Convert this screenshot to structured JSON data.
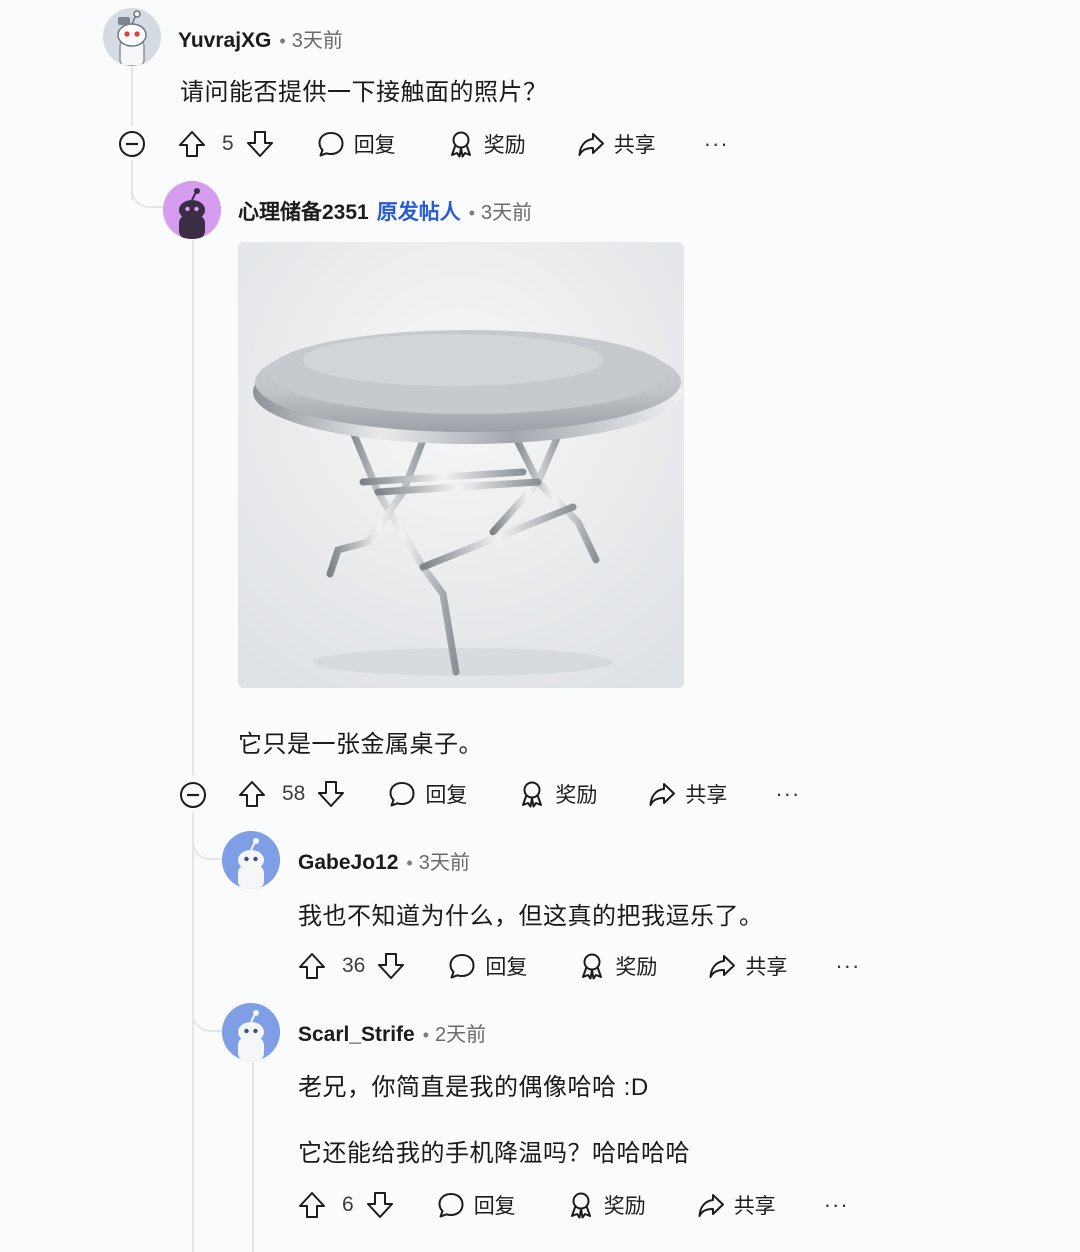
{
  "comments": [
    {
      "username": "YuvrajXG",
      "time": "3天前",
      "text": "请问能否提供一下接触面的照片？",
      "votes": "5"
    },
    {
      "username": "心理储备2351",
      "op_badge": "原发帖人",
      "time": "3天前",
      "text": "它只是一张金属桌子。",
      "votes": "58"
    },
    {
      "username": "GabeJo12",
      "time": "3天前",
      "text": "我也不知道为什么，但这真的把我逗乐了。",
      "votes": "36"
    },
    {
      "username": "Scarl_Strife",
      "time": "2天前",
      "text": "老兄，你简直是我的偶像哈哈 :D",
      "text2": "它还能给我的手机降温吗？哈哈哈哈",
      "votes": "6"
    }
  ],
  "actions": {
    "reply": "回复",
    "award": "奖励",
    "share": "共享",
    "more": "···"
  },
  "icons": [
    "upvote-icon",
    "downvote-icon",
    "reply-bubble-icon",
    "award-icon",
    "share-icon",
    "collapse-icon"
  ],
  "colors": {
    "op_badge": "#2a5bd7",
    "thread_line": "#e3e6e9",
    "avatar_purple": "#d59cf0",
    "avatar_blue": "#7f9ee6"
  }
}
